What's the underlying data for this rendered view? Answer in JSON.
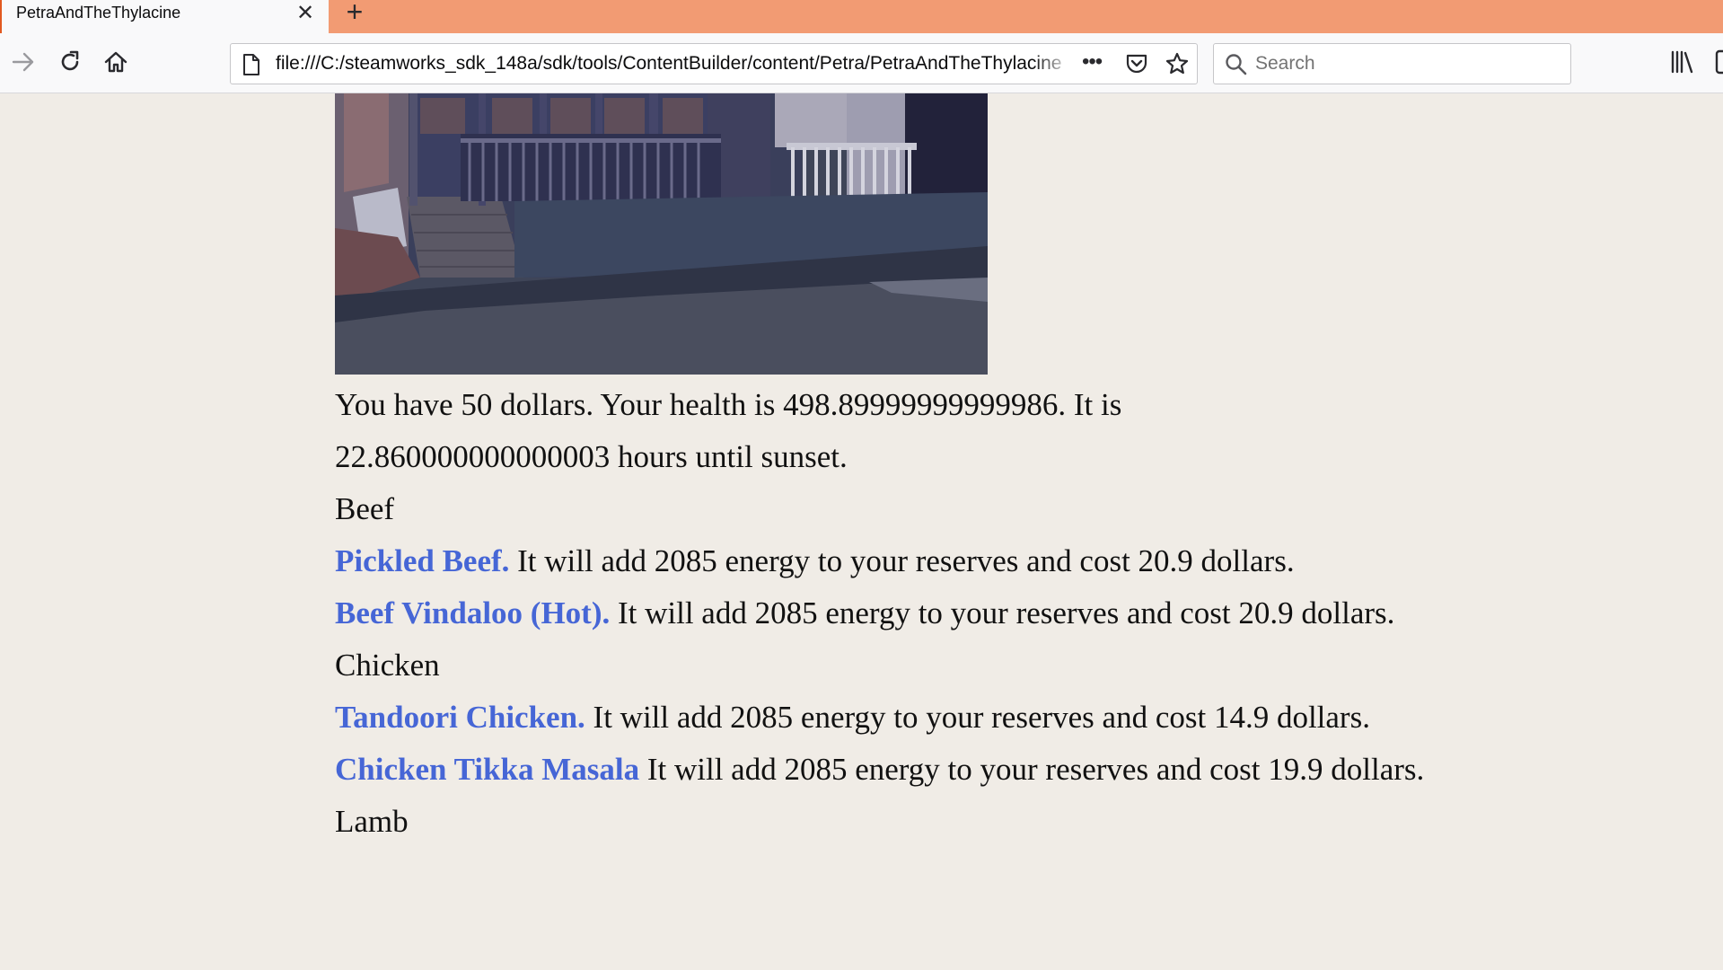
{
  "browser": {
    "tab_title": "PetraAndTheThylacine",
    "tab_close_icon": "close-icon",
    "new_tab_icon": "plus-icon",
    "url": "file:///C:/steamworks_sdk_148a/sdk/tools/ContentBuilder/content/Petra/PetraAndTheThylacine",
    "search_placeholder": "Search",
    "more_label": "•••",
    "colors": {
      "tab_strip": "#f29b73",
      "tab_accent": "#e25920",
      "page_background": "#f0ece6",
      "link": "#4666d6"
    }
  },
  "story": {
    "status_text": "You have 50 dollars. Your health is 498.89999999999986. It is 22.860000000000003 hours until sunset.",
    "sections": [
      {
        "heading": "Beef",
        "items": [
          {
            "name": "Pickled Beef.",
            "description": " It will add 2085 energy to your reserves and cost 20.9 dollars."
          },
          {
            "name": "Beef Vindaloo (Hot).",
            "description": " It will add 2085 energy to your reserves and cost 20.9 dollars."
          }
        ]
      },
      {
        "heading": "Chicken",
        "items": [
          {
            "name": "Tandoori Chicken.",
            "description": " It will add 2085 energy to your reserves and cost 14.9 dollars."
          },
          {
            "name": "Chicken Tikka Masala",
            "description": " It will add 2085 energy to your reserves and cost 19.9 dollars."
          }
        ]
      },
      {
        "heading": "Lamb",
        "items": []
      }
    ]
  }
}
